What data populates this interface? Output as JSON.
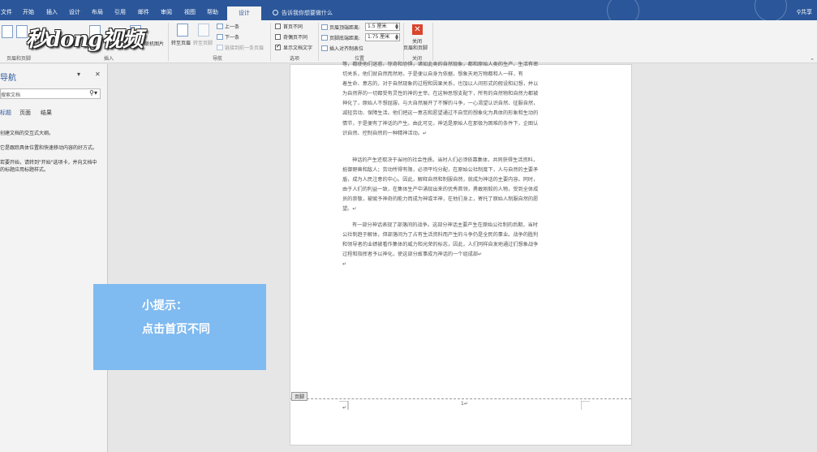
{
  "app": {
    "title_fragment": "文件"
  },
  "tabs": [
    "文件",
    "开始",
    "插入",
    "设计",
    "布局",
    "引用",
    "邮件",
    "审阅",
    "视图",
    "帮助",
    "设计"
  ],
  "tell_me": "告诉我你想要做什么",
  "user": "共享",
  "logo_text": "秒dong视频",
  "ribbon": {
    "header_footer_group": "页眉和页脚",
    "insert_group": "插入",
    "online_pictures": "联机图片",
    "goto_header": "转至页眉",
    "goto_footer": "转至页脚",
    "prev": "上一条",
    "next": "下一条",
    "link_prev": "链接到前一条页眉",
    "nav_group": "导航",
    "diff_first": "首页不同",
    "diff_odd_even": "奇偶页不同",
    "show_doc_text": "显示文档文字",
    "options_group": "选项",
    "header_top_label": "页眉顶端距离:",
    "header_top_value": "1.5 厘米",
    "footer_bottom_label": "页脚底端距离:",
    "footer_bottom_value": "1.75 厘米",
    "insert_align_tab": "插入对齐制表位",
    "position_group": "位置",
    "close_label": "关闭\n页眉和页脚",
    "close_line1": "关闭",
    "close_line2": "页眉和页脚",
    "close_group": "关闭",
    "colors": {
      "accent": "#2b579a",
      "close": "#d9452d"
    }
  },
  "nav_pane": {
    "title": "导航",
    "search_placeholder": "搜索文档",
    "tabs": [
      "标题",
      "页面",
      "结果"
    ],
    "p1": "创建文档的交互式大纲。",
    "p2": "它是跟踪具体位置和快速移动内容的好方式。",
    "p3a": "若要开始，请转到\"开始\"选项卡，并向文档中",
    "p3b": "的标题应用标题样式。"
  },
  "document": {
    "para1": [
      "等，都使他们迷惑、惊奇和恐惧，诸如此类的自然现象，都和原始人类的生产、生活有密",
      "切关系，他们就自然而然地，于是便以自身为依据，想象天地万物都和人一样，有",
      "着生命、意志的，对于自然现象的过程和因果关系，也加以人间形式的假设和幻想，并以",
      "为自然界的一切都受有灵性的神的主宰。在这种思想支配下，所有的自然物和自然力都被",
      "神化了，原始人不想屈服，与大自然展开了不懈的斗争，一心渴望认识自然、征服自然，",
      "减轻劳动、保障生活。他们把这一意志和愿望通过不自觉的想象化为具体的形象和生动的",
      "情节，于是便有了神话的产生。由此可见，神话是原始人在那极为困难的条件下，企图认",
      "识自然、控制自然的一种精神活动。↵"
    ],
    "para2": [
      "神话的产生还取决于当时的社会性质。当时人们必须依靠集体，共同获得生活资料，",
      "抵御野兽和敌人；劳动所得有限，必须平均分配，在原始公社制度下，人与自然的主要矛",
      "盾，成为人民注意的中心。因此，解释自然和制服自然，就成为神话的主要内容。同时，",
      "由于人们的利益一致，在集体生产中涌现出来的优秀首领，勇敢刚毅的人物，受到全体成",
      "员的崇敬，被赋予神奇的能力而成为神或半神，在他们身上，寄托了原始人制服自然的愿",
      "望。↵"
    ],
    "para3": [
      "有一部分神话表现了部落间的战争。这部分神话主要产生在原始公社制的后期，当时",
      "公社制趋于解体，但部落间为了占有生活资料而产生的斗争仍是全民的事业。战争的胜利",
      "和领导者的业绩被看作集体的威力和光荣的标志，因此，人们同样自发地通过们想象战争",
      "过程和指挥者予以神化，使这部分故事成为神话的一个组成部↵"
    ],
    "trailing_mark": "↵",
    "footer_tag": "页脚",
    "footer_mark": "1↵",
    "footer_mark2": "↵"
  },
  "tip": {
    "line1": "小提示：",
    "line2": "点击首页不同"
  }
}
